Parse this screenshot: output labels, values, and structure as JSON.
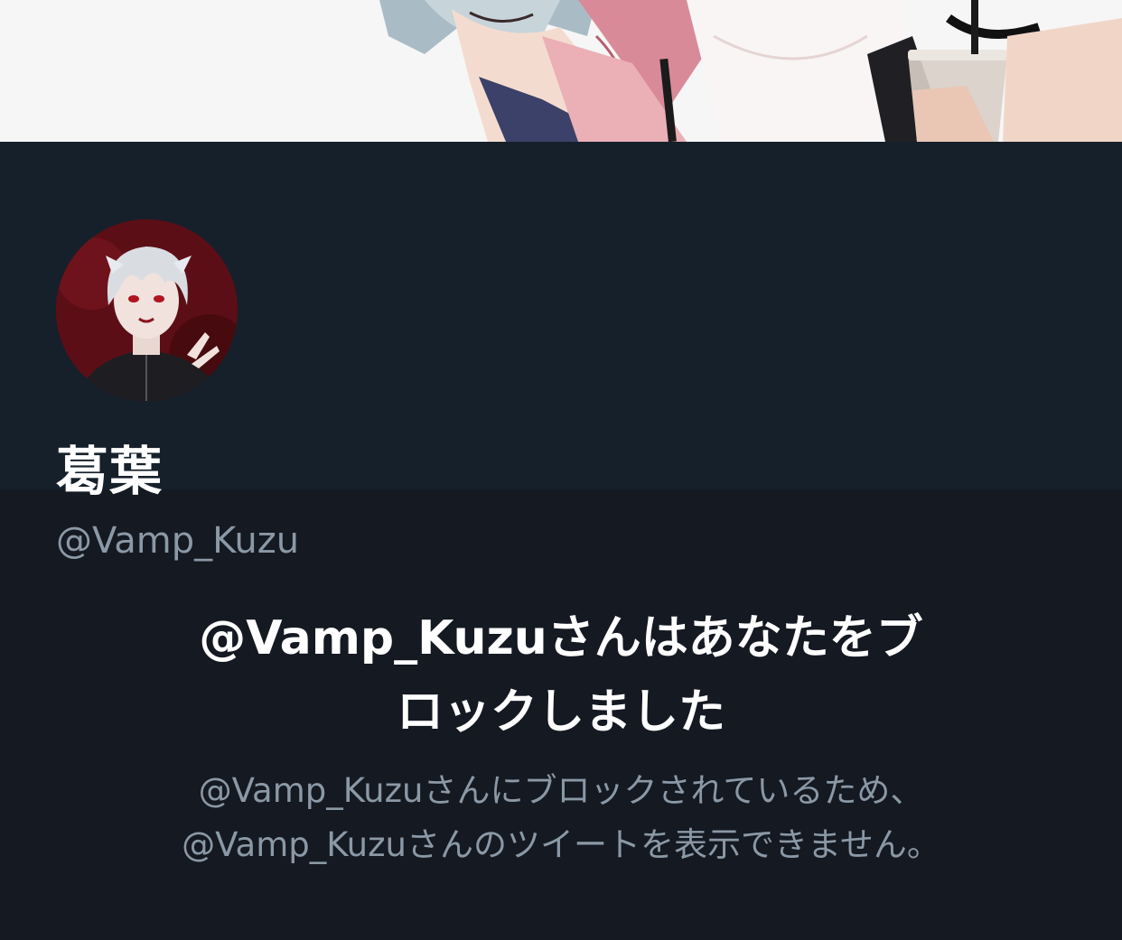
{
  "profile": {
    "display_name": "葛葉",
    "handle": "@Vamp_Kuzu"
  },
  "blocked": {
    "title_line1": "@Vamp_Kuzuさんはあなたをブ",
    "title_line2": "ロックしました",
    "message_line1": "@Vamp_Kuzuさんにブロックされているため、",
    "message_line2": "@Vamp_Kuzuさんのツイートを表示できません。"
  },
  "colors": {
    "header_bg": "#16202b",
    "page_bg": "#141922",
    "primary_text": "#ffffff",
    "secondary_text": "#8b98a5"
  }
}
